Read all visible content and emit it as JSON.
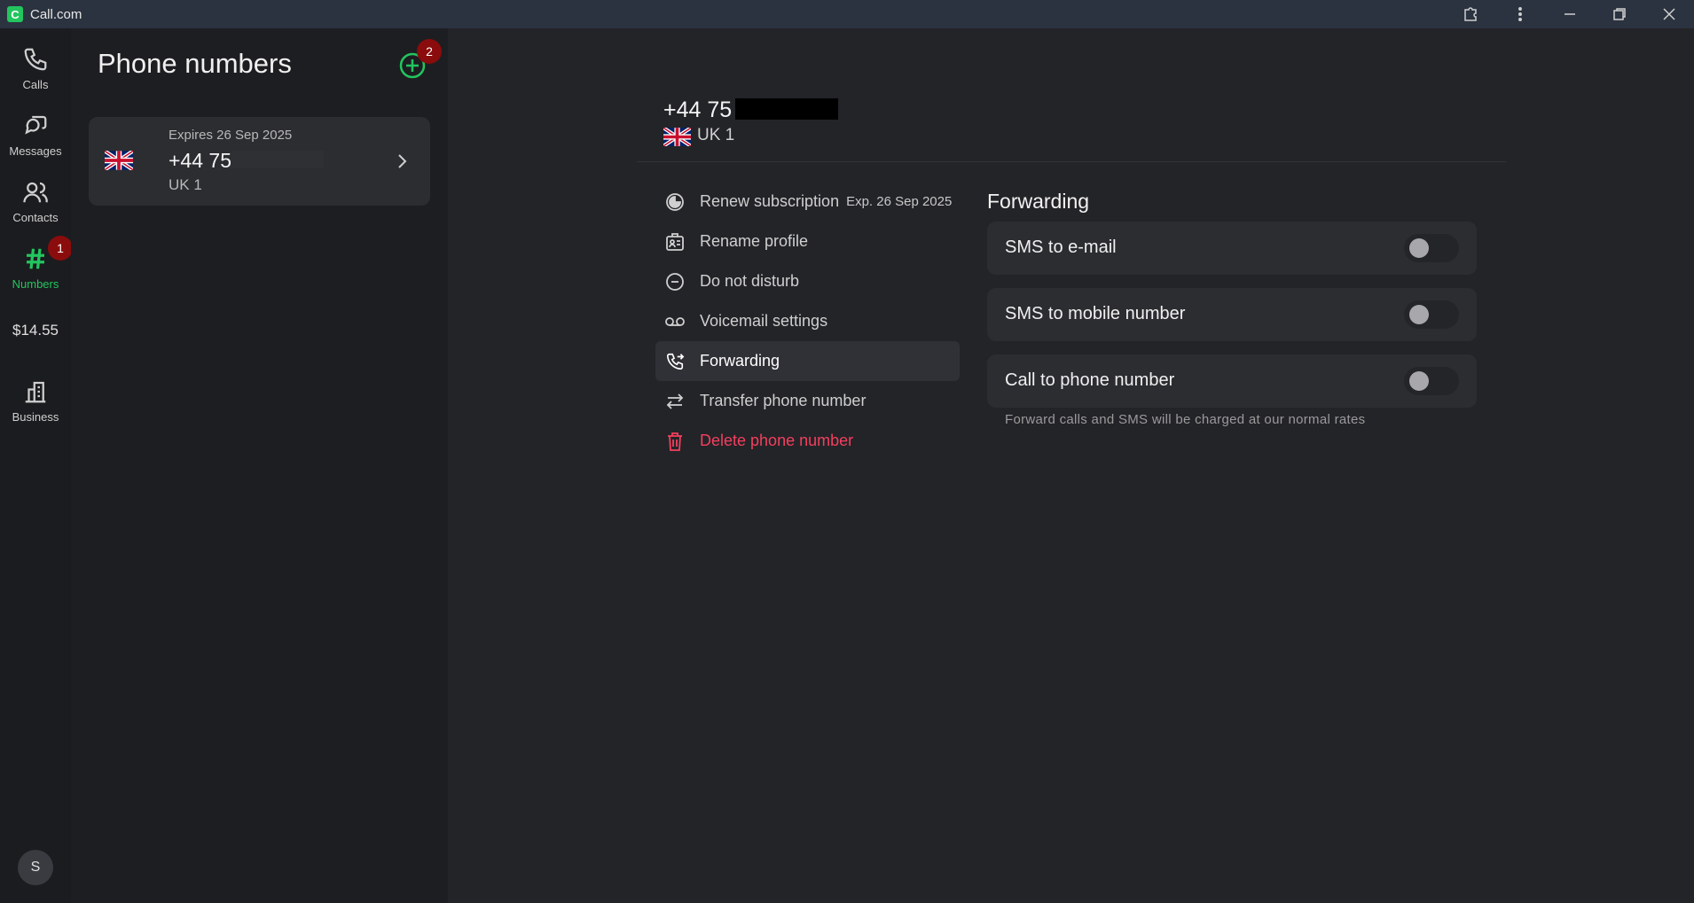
{
  "window": {
    "title": "Call.com",
    "logo_letter": "C"
  },
  "rail": {
    "items": [
      {
        "label": "Calls",
        "icon": "phone-icon"
      },
      {
        "label": "Messages",
        "icon": "chat-icon"
      },
      {
        "label": "Contacts",
        "icon": "contacts-icon"
      },
      {
        "label": "Numbers",
        "icon": "hash-icon",
        "badge": "1"
      },
      {
        "label": "Business",
        "icon": "building-icon"
      }
    ],
    "balance": "$14.55",
    "avatar_letter": "S"
  },
  "list": {
    "title": "Phone numbers",
    "add_badge": "2",
    "card": {
      "expires": "Expires 26 Sep 2025",
      "number": "+44 75",
      "label": "UK 1"
    }
  },
  "detail": {
    "number": "+44 75",
    "label": "UK 1",
    "menu": [
      {
        "label": "Renew subscription",
        "extra": "Exp. 26 Sep 2025",
        "icon": "renew-icon"
      },
      {
        "label": "Rename profile",
        "icon": "id-card-icon"
      },
      {
        "label": "Do not disturb",
        "icon": "minus-circle-icon"
      },
      {
        "label": "Voicemail settings",
        "icon": "voicemail-icon"
      },
      {
        "label": "Forwarding",
        "icon": "call-forward-icon",
        "active": true
      },
      {
        "label": "Transfer phone number",
        "icon": "transfer-icon"
      },
      {
        "label": "Delete phone number",
        "icon": "trash-icon",
        "danger": true
      }
    ],
    "forwarding": {
      "title": "Forwarding",
      "options": [
        {
          "label": "SMS to e-mail",
          "enabled": false
        },
        {
          "label": "SMS to mobile number",
          "enabled": false
        },
        {
          "label": "Call to phone number",
          "enabled": false
        }
      ],
      "note": "Forward calls and SMS will be charged at our normal rates"
    }
  },
  "colors": {
    "accent": "#22c55e",
    "danger": "#f43f5e",
    "badge": "#8b0c0c"
  }
}
